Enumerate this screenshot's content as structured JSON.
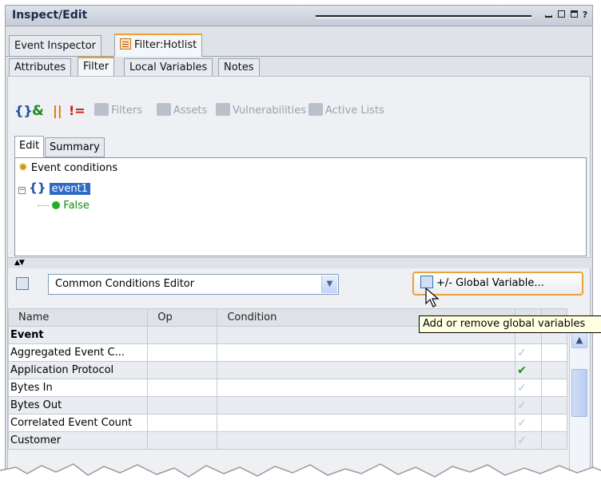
{
  "window": {
    "title": "Inspect/Edit",
    "controls": {
      "help": "?"
    }
  },
  "top_tabs": [
    {
      "label": "Event Inspector",
      "active": false
    },
    {
      "label": "Filter:Hotlist",
      "active": true,
      "icon": "filter-icon"
    }
  ],
  "sub_tabs": [
    {
      "label": "Attributes",
      "active": false
    },
    {
      "label": "Filter",
      "active": true
    },
    {
      "label": "Local Variables",
      "active": false
    },
    {
      "label": "Notes",
      "active": false
    }
  ],
  "toolbar": {
    "filters": "Filters",
    "assets": "Assets",
    "vulnerabilities": "Vulnerabilities",
    "active_lists": "Active Lists"
  },
  "edit_tabs": [
    {
      "label": "Edit",
      "active": true
    },
    {
      "label": "Summary",
      "active": false
    }
  ],
  "tree": {
    "root": "Event conditions",
    "node": "event1",
    "leaf": "False"
  },
  "editor": {
    "selected": "Common Conditions Editor",
    "global_button": "+/- Global Variable...",
    "tooltip": "Add or remove global variables"
  },
  "grid": {
    "columns": [
      "Name",
      "Op",
      "Condition"
    ],
    "rows": [
      {
        "name": "Event",
        "group": true,
        "checked": null
      },
      {
        "name": "Aggregated Event C...",
        "group": false,
        "checked": false
      },
      {
        "name": "Application Protocol",
        "group": false,
        "checked": true
      },
      {
        "name": "Bytes In",
        "group": false,
        "checked": false
      },
      {
        "name": "Bytes Out",
        "group": false,
        "checked": false
      },
      {
        "name": "Correlated Event Count",
        "group": false,
        "checked": false
      },
      {
        "name": "Customer",
        "group": false,
        "checked": false
      }
    ]
  },
  "colors": {
    "accent": "#f0a030",
    "selection": "#316ac5",
    "check_on": "#1b8f1b"
  }
}
